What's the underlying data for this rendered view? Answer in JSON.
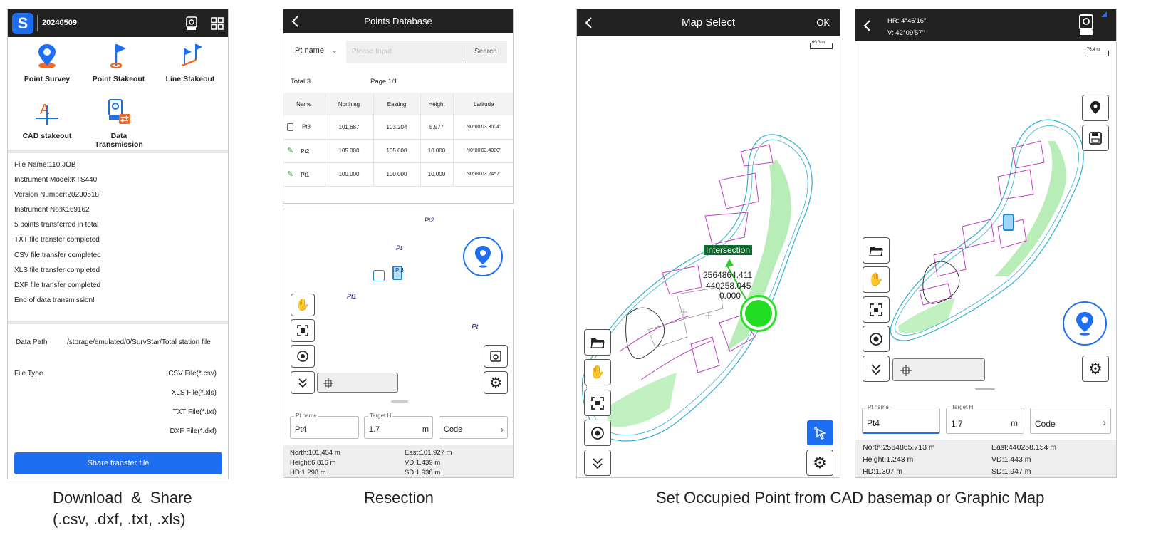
{
  "s1": {
    "project": "20240509",
    "menu": [
      "Point Survey",
      "Point Stakeout",
      "Line Stakeout",
      "CAD stakeout",
      "Data\nTransmission"
    ],
    "log": [
      "File Name:110.JOB",
      "Instrument Model:KTS440",
      "Version Number:20230518",
      "Instrument No:K169162",
      "5 points transferred in total",
      "TXT file transfer completed",
      "CSV file transfer completed",
      "XLS file transfer completed",
      "DXF file transfer completed",
      "End of data transmission!"
    ],
    "data_path_label": "Data Path",
    "data_path": "/storage/emulated/0/SurvStar/Total station file",
    "file_type_label": "File Type",
    "file_types": [
      "CSV File(*.csv)",
      "XLS File(*.xls)",
      "TXT File(*.txt)",
      "DXF File(*.dxf)"
    ],
    "share_button": "Share transfer file"
  },
  "s2": {
    "title": "Points Database",
    "filter": "Pt name",
    "search_placeholder": "Please Input",
    "search_button": "Search",
    "total": "Total 3",
    "page": "Page 1/1",
    "columns": [
      "Name",
      "Northing",
      "Easting",
      "Height",
      "Latitude"
    ],
    "rows": [
      {
        "icon": "instrument-icon",
        "name": "Pt3",
        "northing": "101.687",
        "easting": "103.204",
        "height": "5.577",
        "latitude": "N0°00'03.3004\""
      },
      {
        "icon": "pencil-icon",
        "name": "Pt2",
        "northing": "105.000",
        "easting": "105.000",
        "height": "10.000",
        "latitude": "N0°00'03.4080\""
      },
      {
        "icon": "pencil-icon",
        "name": "Pt1",
        "northing": "100.000",
        "easting": "100.000",
        "height": "10.000",
        "latitude": "N0°00'03.2457\""
      }
    ],
    "map_labels": {
      "pt2": "Pt2",
      "pt_a": "Pt",
      "pt3": "Pt3",
      "pt1": "Pt1",
      "pt_b": "Pt"
    },
    "ptname_label": "Pt name",
    "ptname": "Pt4",
    "targeth_label": "Target H",
    "targeth": "1.7",
    "unit": "m",
    "code": "Code",
    "status": {
      "north": "North:101.454 m",
      "east": "East:101.927 m",
      "height": "Height:6.816 m",
      "vd": "VD:1.439 m",
      "hd": "HD:1.298 m",
      "sd": "SD:1.938 m"
    }
  },
  "s3": {
    "title": "Map Select",
    "ok": "OK",
    "scale": "60.3 m",
    "intersection": "Intersection",
    "coord_n": "2564864.411",
    "coord_e": "440258.045",
    "coord_h": "0.000"
  },
  "s4": {
    "hr": "HR: 4°46'16\"",
    "v": "V: 42°09'57\"",
    "scale": "76.4 m",
    "ptname_label": "Pt name",
    "ptname": "Pt4",
    "targeth_label": "Target H",
    "targeth": "1.7",
    "unit": "m",
    "code": "Code",
    "status": {
      "north": "North:2564865.713 m",
      "east": "East:440258.154 m",
      "height": "Height:1.243 m",
      "vd": "VD:1.443 m",
      "hd": "HD:1.307 m",
      "sd": "SD:1.947 m"
    }
  },
  "captions": {
    "c1a": "Download  &  Share",
    "c1b": "(.csv, .dxf, .txt, .xls)",
    "c2": "Resection",
    "c3": "Set Occupied Point from CAD basemap or Graphic Map"
  },
  "colors": {
    "blue": "#1e6ef2",
    "bar": "#222222",
    "cad_magenta": "#c040c0",
    "cad_green": "#33cc33",
    "cad_cyan": "#30b0d0",
    "orange": "#ee6a2a"
  }
}
